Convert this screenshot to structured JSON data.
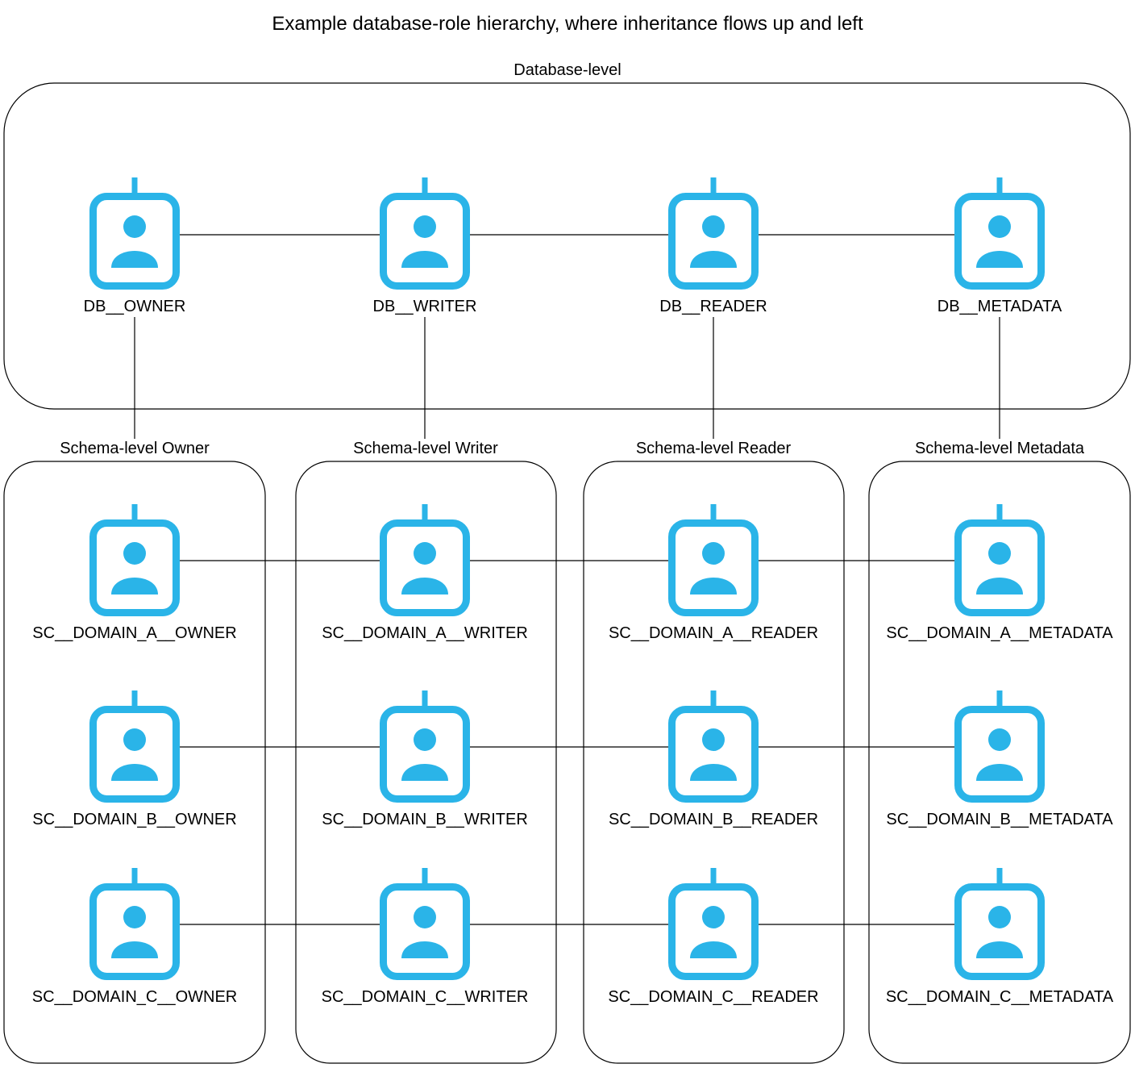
{
  "title": "Example database-role hierarchy, where inheritance flows up and left",
  "colors": {
    "icon": "#2ab4e8",
    "line": "#000000",
    "text": "#000000",
    "background": "#ffffff"
  },
  "icon_semantic": "user-badge-icon",
  "groups": {
    "database": {
      "label": "Database-level"
    },
    "owner": {
      "label": "Schema-level Owner"
    },
    "writer": {
      "label": "Schema-level Writer"
    },
    "reader": {
      "label": "Schema-level Reader"
    },
    "metadata": {
      "label": "Schema-level Metadata"
    }
  },
  "roles": {
    "db_owner": "DB__OWNER",
    "db_writer": "DB__WRITER",
    "db_reader": "DB__READER",
    "db_metadata": "DB__METADATA",
    "a_owner": "SC__DOMAIN_A__OWNER",
    "a_writer": "SC__DOMAIN_A__WRITER",
    "a_reader": "SC__DOMAIN_A__READER",
    "a_metadata": "SC__DOMAIN_A__METADATA",
    "b_owner": "SC__DOMAIN_B__OWNER",
    "b_writer": "SC__DOMAIN_B__WRITER",
    "b_reader": "SC__DOMAIN_B__READER",
    "b_metadata": "SC__DOMAIN_B__METADATA",
    "c_owner": "SC__DOMAIN_C__OWNER",
    "c_writer": "SC__DOMAIN_C__WRITER",
    "c_reader": "SC__DOMAIN_C__READER",
    "c_metadata": "SC__DOMAIN_C__METADATA"
  }
}
